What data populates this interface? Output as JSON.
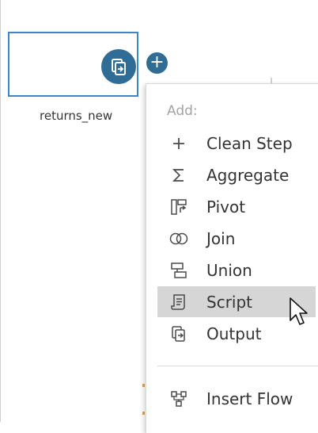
{
  "canvas": {
    "node_label": "returns_new",
    "add_button_symbol": "+"
  },
  "menu": {
    "header": "Add:",
    "items": [
      {
        "label": "Clean Step",
        "icon": "plus-icon"
      },
      {
        "label": "Aggregate",
        "icon": "sigma-icon"
      },
      {
        "label": "Pivot",
        "icon": "pivot-icon"
      },
      {
        "label": "Join",
        "icon": "join-icon"
      },
      {
        "label": "Union",
        "icon": "union-icon"
      },
      {
        "label": "Script",
        "icon": "script-icon",
        "highlighted": true
      },
      {
        "label": "Output",
        "icon": "output-icon"
      }
    ],
    "insert_flow": {
      "label": "Insert Flow",
      "icon": "insert-flow-icon"
    }
  },
  "colors": {
    "accent": "#2f6d96",
    "node_border": "#3a86c8",
    "highlight": "#d6d6d6"
  }
}
